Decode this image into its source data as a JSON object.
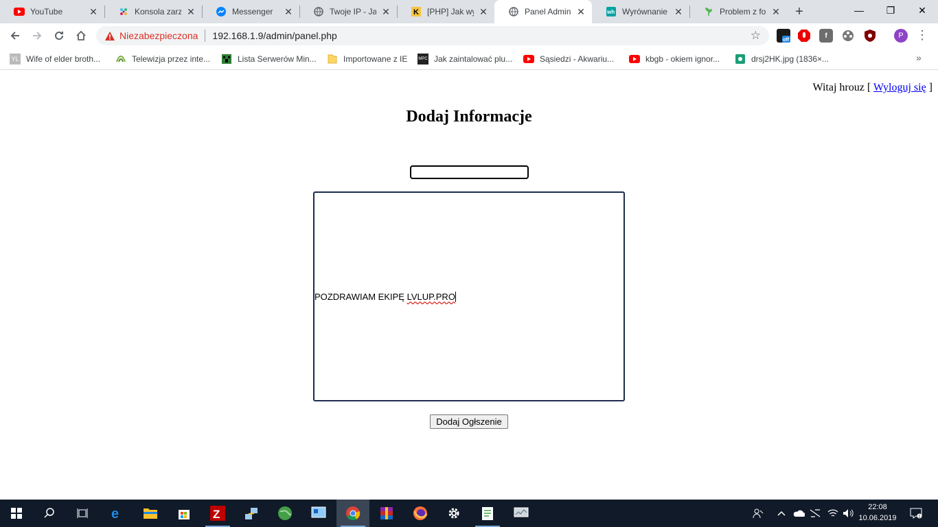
{
  "browser": {
    "tabs": [
      {
        "title": "YouTube",
        "icon": "youtube-icon",
        "active": false
      },
      {
        "title": "Konsola zarząd",
        "icon": "slack-icon",
        "active": false
      },
      {
        "title": "Messenger",
        "icon": "messenger-icon",
        "active": false
      },
      {
        "title": "Twoje IP - Jaki",
        "icon": "globe-icon",
        "active": false
      },
      {
        "title": "[PHP] Jak wyśw",
        "icon": "k-icon",
        "active": false
      },
      {
        "title": "Panel Admina",
        "icon": "globe-icon",
        "active": true
      },
      {
        "title": "Wyrównanie z",
        "icon": "wh-icon",
        "active": false
      },
      {
        "title": "Problem z form",
        "icon": "plant-icon",
        "active": false
      }
    ],
    "window_controls": {
      "minimize": "—",
      "restore": "❐",
      "close": "✕"
    },
    "address": {
      "security_label": "Niezabezpieczona",
      "url": "192.168.1.9/admin/panel.php"
    },
    "bookmarks": [
      {
        "label": "Wife of elder broth...",
        "icon": "yl-icon"
      },
      {
        "label": "Telewizja przez inte...",
        "icon": "tv-icon"
      },
      {
        "label": "Lista Serwerów Min...",
        "icon": "minecraft-icon"
      },
      {
        "label": "Importowane z IE",
        "icon": "folder-icon"
      },
      {
        "label": "Jak zaintalować plu...",
        "icon": "mpc-icon"
      },
      {
        "label": "Sąsiedzi - Akwariu...",
        "icon": "youtube-icon"
      },
      {
        "label": "kbgb - okiem ignor...",
        "icon": "youtube-icon"
      },
      {
        "label": "drsj2HK.jpg (1836×...",
        "icon": "image-icon"
      }
    ],
    "profile_initial": "P"
  },
  "page": {
    "welcome_prefix": "Witaj hrouz [ ",
    "logout_link": "Wyloguj się",
    "welcome_suffix": " ]",
    "title": "Dodaj Informacje",
    "title_input_value": "",
    "content_text_plain": "POZDRAWIAM EKIPĘ ",
    "content_text_misspelled": "LVLUP.PRO",
    "submit_label": "Dodaj Ogłszenie"
  },
  "taskbar": {
    "time": "22:08",
    "date": "10.06.2019",
    "items": [
      "start-icon",
      "search-icon",
      "task-view-icon",
      "edge-icon",
      "file-explorer-icon",
      "store-icon",
      "filezilla-icon",
      "network-app-icon",
      "globe-app-icon",
      "control-panel-icon",
      "chrome-icon",
      "winrar-icon",
      "firefox-icon",
      "settings-icon",
      "notepad-icon",
      "monitor-icon"
    ]
  },
  "colors": {
    "insecure_red": "#d93025",
    "link_blue": "#0000ee",
    "taskbar_bg": "#101a28",
    "tabstrip_bg": "#dee1e6"
  }
}
